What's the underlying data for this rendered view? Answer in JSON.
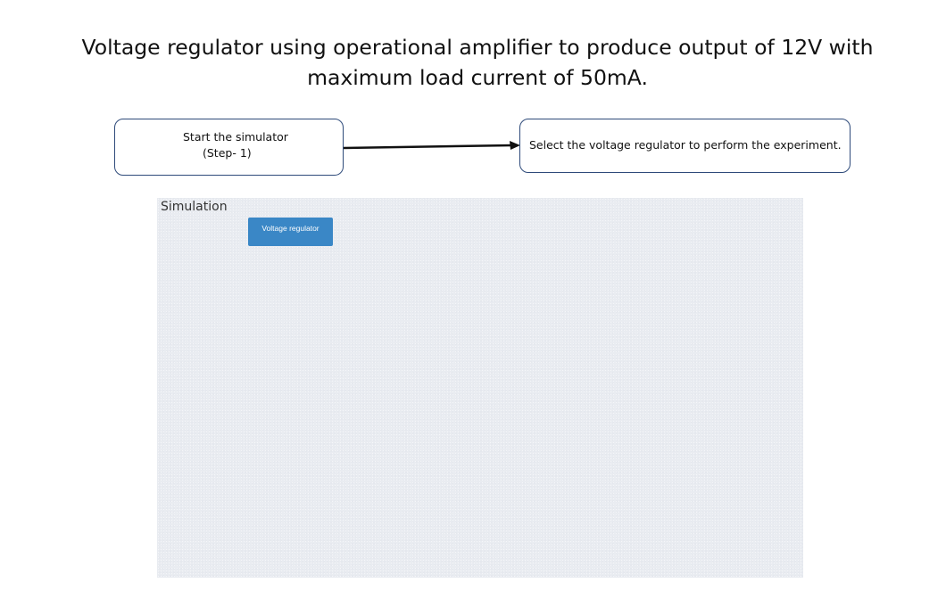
{
  "page": {
    "title": "Voltage regulator using operational amplifier to produce output of 12V with maximum load current of 50mA."
  },
  "flow": {
    "step_box": {
      "line1": "Start the simulator",
      "line2": "(Step- 1)"
    },
    "instruction": "Select the voltage regulator to perform the experiment."
  },
  "simulation": {
    "label": "Simulation",
    "button_label": "Voltage regulator",
    "accent_color": "#3a87c6",
    "panel_color": "#e9ecf1"
  },
  "icons": {
    "connector": "arrow-right-icon"
  }
}
